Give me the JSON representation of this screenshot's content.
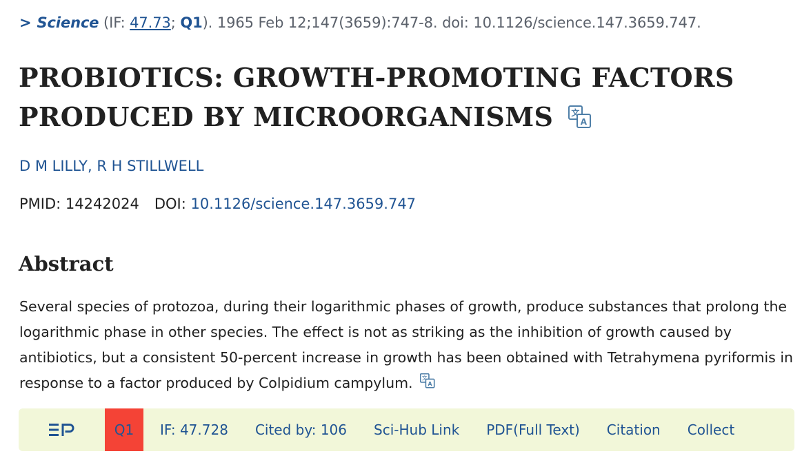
{
  "citation": {
    "journal": "Science",
    "if_prefix": " (IF: ",
    "if_value": "47.73",
    "separator": "; ",
    "quartile": "Q1",
    "suffix": "). 1965 Feb 12;147(3659):747-8. doi: 10.1126/science.147.3659.747."
  },
  "article": {
    "title_line1": "PROBIOTICS: GROWTH-PROMOTING FACTORS",
    "title_line2": "PRODUCED BY MICROORGANISMS",
    "authors": [
      {
        "name": "D M LILLY"
      },
      {
        "name": "R H STILLWELL"
      }
    ],
    "author_separator": ", ",
    "pmid_label": "PMID:",
    "pmid": "14242024",
    "doi_label": "DOI:",
    "doi": "10.1126/science.147.3659.747"
  },
  "abstract": {
    "heading": "Abstract",
    "text": "Several species of protozoa, during their logarithmic phases of growth, produce substances that prolong the logarithmic phase in other species. The effect is not as striking as the inhibition of growth caused by antibiotics, but a consistent 50-percent increase in growth has been obtained with Tetrahymena pyriformis in response to a factor produced by Colpidium campylum."
  },
  "toolbar": {
    "logo_icon": "easy-pubmed-logo-icon",
    "quartile": "Q1",
    "quartile_color": "#f44336",
    "impact_factor": "IF: 47.728",
    "cited_by": "Cited by: 106",
    "scihub": "Sci-Hub Link",
    "pdf": "PDF(Full Text)",
    "citation": "Citation",
    "collect": "Collect"
  },
  "colors": {
    "link": "#205493",
    "toolbar_bg": "#f2f7d9",
    "text": "#212121"
  }
}
